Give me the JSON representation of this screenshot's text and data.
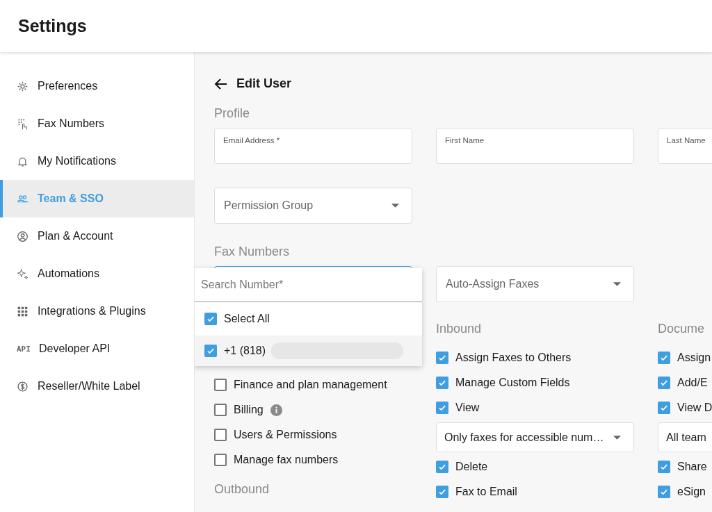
{
  "header": {
    "title": "Settings"
  },
  "sidebar": {
    "items": [
      {
        "label": "Preferences",
        "selected": false
      },
      {
        "label": "Fax Numbers",
        "selected": false
      },
      {
        "label": "My Notifications",
        "selected": false
      },
      {
        "label": "Team & SSO",
        "selected": true
      },
      {
        "label": "Plan & Account",
        "selected": false
      },
      {
        "label": "Automations",
        "selected": false
      },
      {
        "label": "Integrations & Plugins",
        "selected": false
      },
      {
        "label": "Developer API",
        "icon_text": "API",
        "selected": false
      },
      {
        "label": "Reseller/White Label",
        "selected": false
      }
    ]
  },
  "page": {
    "title": "Edit User"
  },
  "profile": {
    "heading": "Profile",
    "fields": [
      {
        "label": "Email Address *"
      },
      {
        "label": "First Name"
      },
      {
        "label": "Last Name"
      }
    ],
    "permission_group": {
      "placeholder": "Permission Group"
    }
  },
  "fax_numbers": {
    "heading": "Fax Numbers",
    "number_access": {
      "focused": true
    },
    "auto_assign": {
      "placeholder": "Auto-Assign Faxes"
    }
  },
  "number_dropdown": {
    "search": {
      "placeholder": "Search Number*"
    },
    "options": [
      {
        "label": "Select All",
        "checked": true,
        "highlighted": false,
        "redacted": false
      },
      {
        "label": "+1 (818)",
        "checked": true,
        "highlighted": true,
        "redacted": true
      }
    ]
  },
  "permissions": {
    "columns": [
      {
        "items": [
          {
            "kind": "checkbox",
            "label": "Finance and plan management",
            "checked": false
          },
          {
            "kind": "checkbox",
            "label": "Billing",
            "checked": false,
            "info": true
          },
          {
            "kind": "checkbox",
            "label": "Users & Permissions",
            "checked": false
          },
          {
            "kind": "checkbox",
            "label": "Manage fax numbers",
            "checked": false
          }
        ],
        "footer_heading": "Outbound"
      },
      {
        "heading": "Inbound",
        "items": [
          {
            "kind": "checkbox",
            "label": "Assign Faxes to Others",
            "checked": true
          },
          {
            "kind": "checkbox",
            "label": "Manage Custom Fields",
            "checked": true
          },
          {
            "kind": "checkbox",
            "label": "View",
            "checked": true
          },
          {
            "kind": "select",
            "value": "Only faxes for accessible num…"
          },
          {
            "kind": "checkbox",
            "label": "Delete",
            "checked": true
          },
          {
            "kind": "checkbox",
            "label": "Fax to Email",
            "checked": true
          }
        ]
      },
      {
        "heading": "Docume",
        "items": [
          {
            "kind": "checkbox",
            "label": "Assign",
            "checked": true
          },
          {
            "kind": "checkbox",
            "label": "Add/E",
            "checked": true
          },
          {
            "kind": "checkbox",
            "label": "View D",
            "checked": true
          },
          {
            "kind": "select",
            "value": "All team"
          },
          {
            "kind": "checkbox",
            "label": "Share",
            "checked": true
          },
          {
            "kind": "checkbox",
            "label": "eSign",
            "checked": true
          }
        ]
      }
    ]
  }
}
